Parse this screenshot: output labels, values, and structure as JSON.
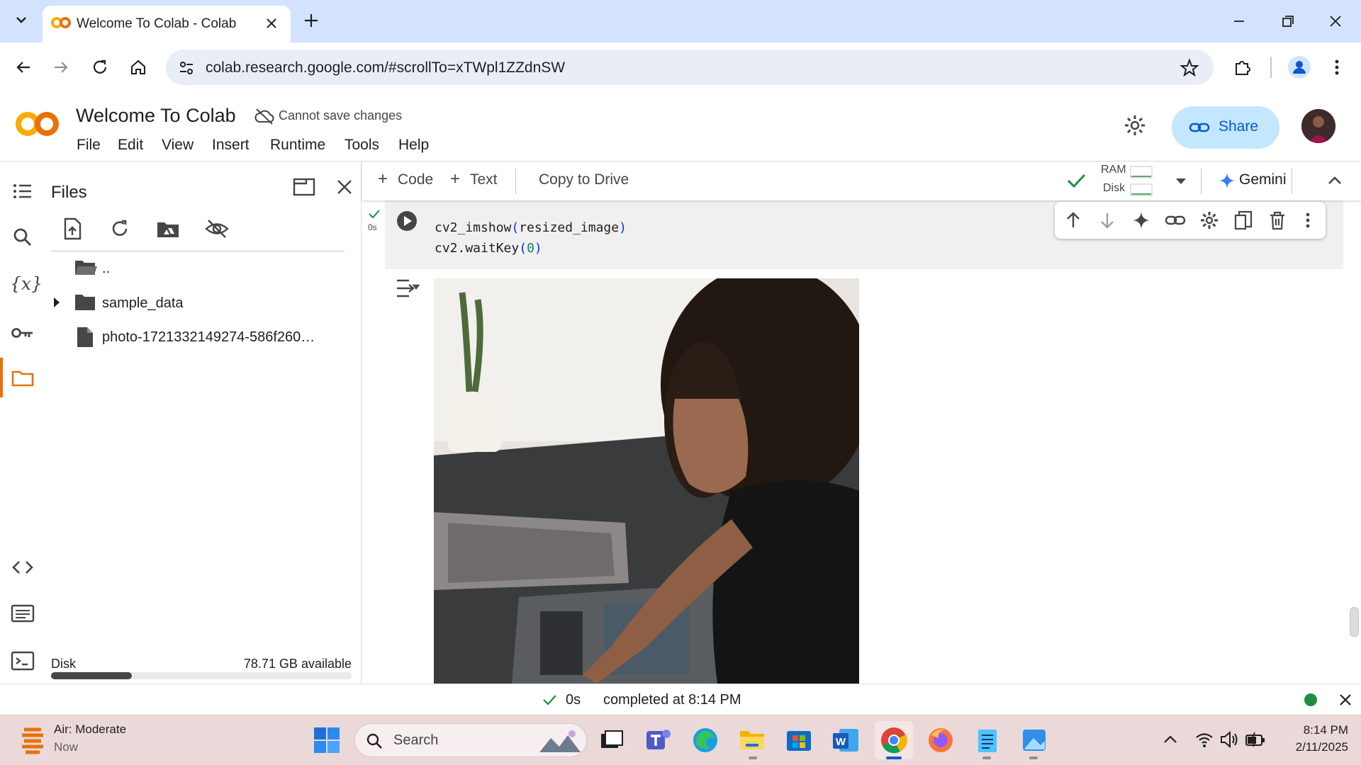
{
  "browser": {
    "tab_title": "Welcome To Colab - Colab",
    "url": "colab.research.google.com/#scrollTo=xTWpl1ZZdnSW"
  },
  "colab": {
    "notebook_title": "Welcome To Colab",
    "save_status": "Cannot save changes",
    "menu": [
      "File",
      "Edit",
      "View",
      "Insert",
      "Runtime",
      "Tools",
      "Help"
    ],
    "share_label": "Share"
  },
  "files_panel": {
    "title": "Files",
    "parent_dir": "..",
    "items": [
      {
        "name": "sample_data",
        "type": "folder"
      },
      {
        "name": "photo-1721332149274-586f260…",
        "type": "file"
      }
    ],
    "disk_label": "Disk",
    "disk_available": "78.71 GB available",
    "disk_used_fraction": 0.27
  },
  "notebook_toolbar": {
    "code_label": "Code",
    "text_label": "Text",
    "copy_label": "Copy to Drive",
    "ram_label": "RAM",
    "disk_label": "Disk",
    "gemini_label": "Gemini"
  },
  "cell": {
    "exec_time": "0s",
    "code_line1_fn": "cv2_imshow",
    "code_line1_arg": "resized_image",
    "code_line2_fn": "cv2.waitKey",
    "code_line2_arg": "0"
  },
  "statusbar": {
    "time": "0s",
    "message": "completed at 8:14 PM"
  },
  "taskbar": {
    "weather_title": "Air: Moderate",
    "weather_sub": "Now",
    "search_placeholder": "Search",
    "clock_time": "8:14 PM",
    "clock_date": "2/11/2025"
  },
  "colors": {
    "colab_orange": "#f9ab00",
    "share_bg": "#c2e7ff",
    "tabstrip": "#d3e3fd",
    "status_green": "#1e8e3e"
  }
}
